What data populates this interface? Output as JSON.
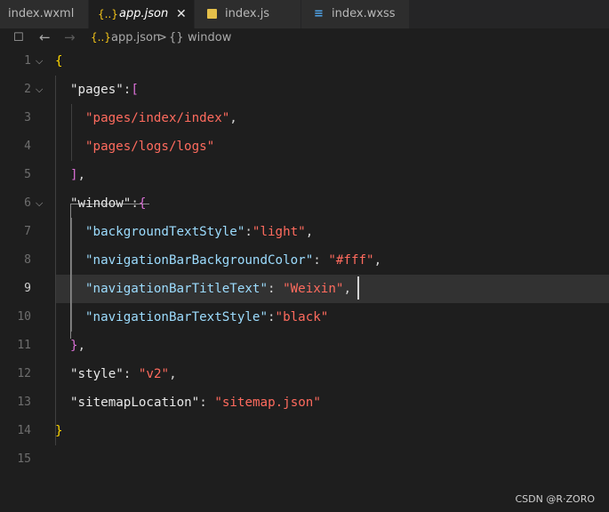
{
  "tabs": [
    {
      "label": "index.wxml",
      "icon": "wxml-file-icon",
      "active": false
    },
    {
      "label": "app.json",
      "icon": "json-file-icon",
      "active": true,
      "close": "✕"
    },
    {
      "label": "index.js",
      "icon": "js-file-icon",
      "active": false
    },
    {
      "label": "index.wxss",
      "icon": "css-file-icon",
      "active": false
    }
  ],
  "breadcrumb": {
    "file": "app.json",
    "separator": ">",
    "symbol_icon": "{}",
    "symbol": "window",
    "json_icon": "{..}"
  },
  "editor": {
    "current_line": 9,
    "line_numbers": [
      "1",
      "2",
      "3",
      "4",
      "5",
      "6",
      "7",
      "8",
      "9",
      "10",
      "11",
      "12",
      "13",
      "14",
      "15"
    ],
    "lines": {
      "l1": {
        "brace_open": "{"
      },
      "l2": {
        "key": "\"pages\"",
        "colon": ":",
        "bracket": "["
      },
      "l3": {
        "value": "\"pages/index/index\"",
        "comma": ","
      },
      "l4": {
        "value": "\"pages/logs/logs\""
      },
      "l5": {
        "bracket_close": "]",
        "comma": ","
      },
      "l6": {
        "key": "\"window\"",
        "colon": ":",
        "brace": "{"
      },
      "l7": {
        "key": "\"backgroundTextStyle\"",
        "colon": ":",
        "value": "\"light\"",
        "comma": ","
      },
      "l8": {
        "key": "\"navigationBarBackgroundColor\"",
        "colon": ": ",
        "value": "\"#fff\"",
        "comma": ","
      },
      "l9": {
        "key": "\"navigationBarTitleText\"",
        "colon": ": ",
        "value": "\"Weixin\"",
        "comma": ","
      },
      "l10": {
        "key": "\"navigationBarTextStyle\"",
        "colon": ":",
        "value": "\"black\""
      },
      "l11": {
        "brace_close": "}",
        "comma": ","
      },
      "l12": {
        "key": "\"style\"",
        "colon": ": ",
        "value": "\"v2\"",
        "comma": ","
      },
      "l13": {
        "key": "\"sitemapLocation\"",
        "colon": ": ",
        "value": "\"sitemap.json\""
      },
      "l14": {
        "brace_close": "}"
      }
    }
  },
  "watermark": "CSDN @R·ZORO",
  "colors": {
    "string": "#ff6b5e",
    "key": "#9cdcfe",
    "brace": "#ffd700",
    "bracket": "#da70d6",
    "background": "#1e1e1e"
  }
}
